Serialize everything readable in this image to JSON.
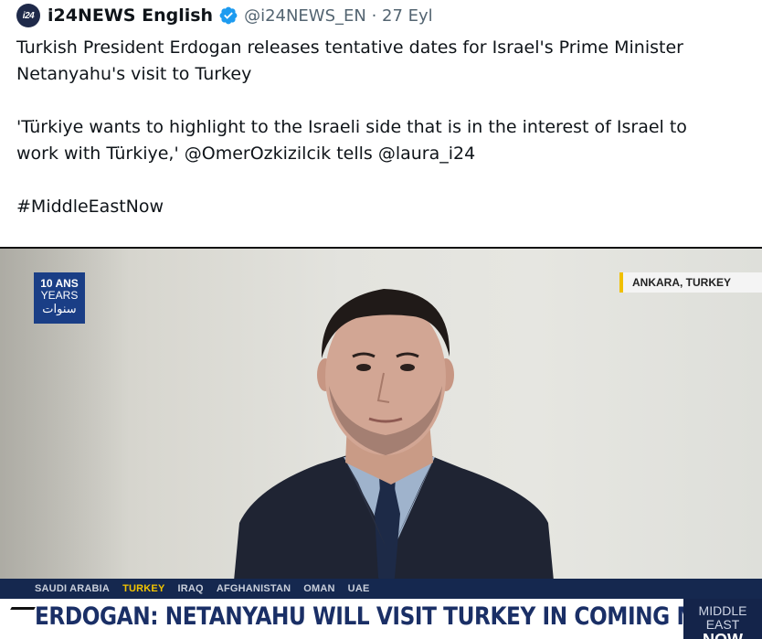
{
  "tweet": {
    "avatar_text": "i24",
    "display_name": "i24NEWS English",
    "handle_date": "@i24NEWS_EN · 27 Eyl",
    "line1": "Turkish President Erdogan releases tentative dates for Israel's Prime Minister",
    "line2": "Netanyahu's visit to Turkey",
    "line3": "'Türkiye wants to highlight to the Israeli side that is in the interest of Israel to",
    "line4": "work with Türkiye,' @OmerOzkizilcik tells @laura_i24",
    "hashtag": "#MiddleEastNow",
    "colors": {
      "text": "#0f1419",
      "muted": "#536471",
      "verified": "#1d9bf0"
    }
  },
  "video": {
    "logo": {
      "line1": "10 ANS",
      "line2": "YEARS",
      "line3": "سنوات"
    },
    "location": "ANKARA, TURKEY",
    "ticker": [
      "SAUDI ARABIA",
      "TURKEY",
      "IRAQ",
      "AFGHANISTAN",
      "OMAN",
      "UAE"
    ],
    "ticker_active": "TURKEY",
    "headline": "ERDOGAN: NETANYAHU WILL VISIT TURKEY IN COMING MONTHS",
    "show": {
      "line1": "MIDDLE EAST",
      "line2": "NOW"
    },
    "colors": {
      "ticker_bg": "#15284f",
      "ticker_active": "#f3c400",
      "headline": "#1a2f66",
      "logo_bg": "#1a3e86"
    }
  }
}
